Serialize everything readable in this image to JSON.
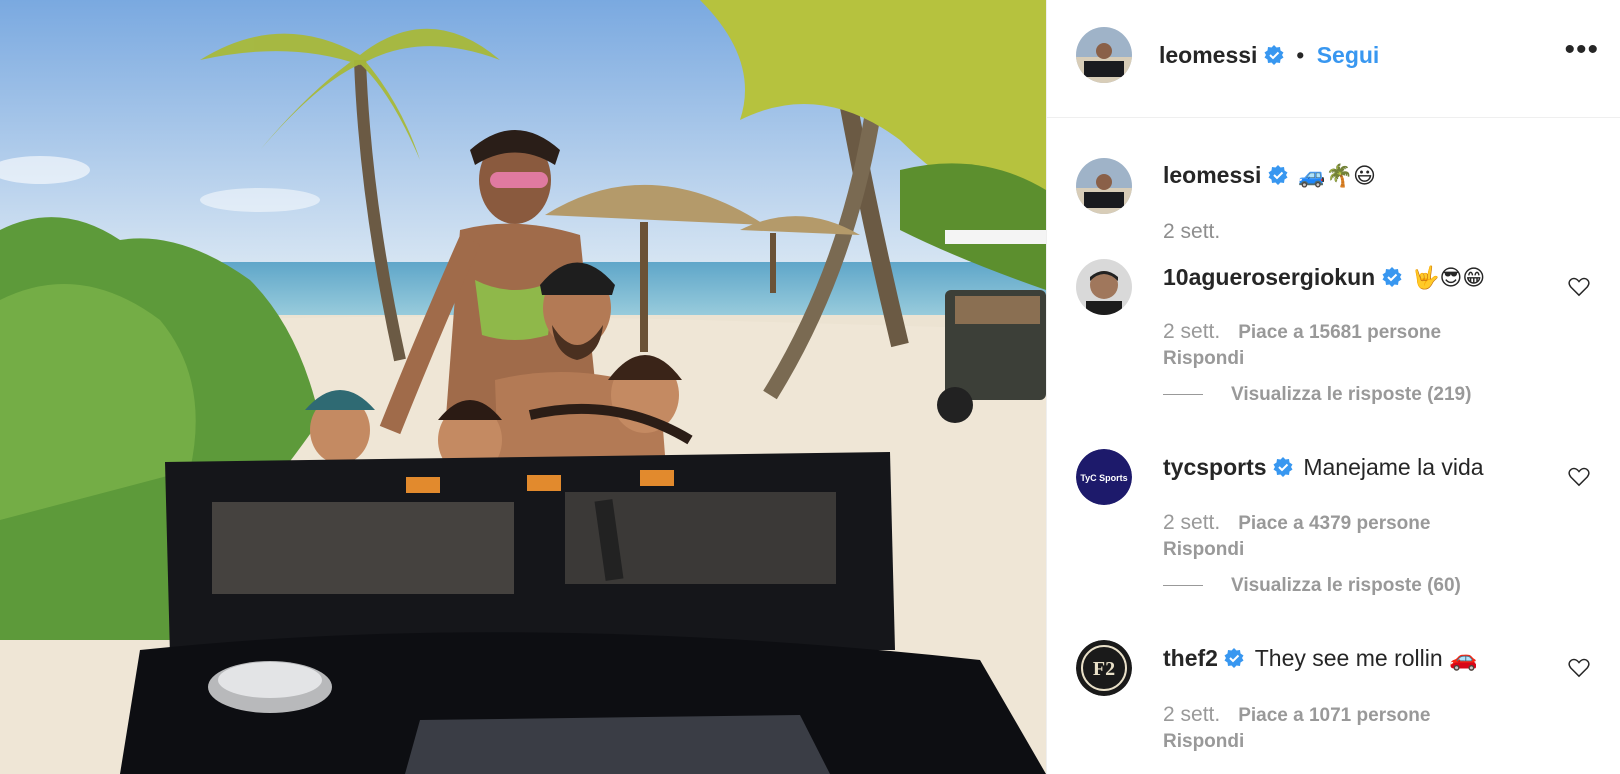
{
  "post": {
    "author": "leomessi",
    "follow_label": "Segui",
    "separator": "•",
    "more_label": "•••",
    "caption": {
      "user": "leomessi",
      "text": "🚙🌴😃",
      "time": "2 sett."
    }
  },
  "comments": [
    {
      "user": "10aguerosergiokun",
      "text": "🤟😎😁",
      "time": "2 sett.",
      "likes": "Piace a 15681 persone",
      "reply": "Rispondi",
      "view_replies": "Visualizza le risposte (219)"
    },
    {
      "user": "tycsports",
      "text": "Manejame la vida",
      "time": "2 sett.",
      "likes": "Piace a 4379 persone",
      "reply": "Rispondi",
      "view_replies": "Visualizza le risposte (60)",
      "avatar_text": "TyC Sports"
    },
    {
      "user": "thef2",
      "text": "They see me rollin 🚗",
      "time": "2 sett.",
      "likes": "Piace a 1071 persone",
      "reply": "Rispondi",
      "avatar_text": "F2"
    }
  ],
  "colors": {
    "link": "#3897f0",
    "verified": "#3897f0",
    "muted": "#8e8e8e",
    "text": "#262626"
  }
}
